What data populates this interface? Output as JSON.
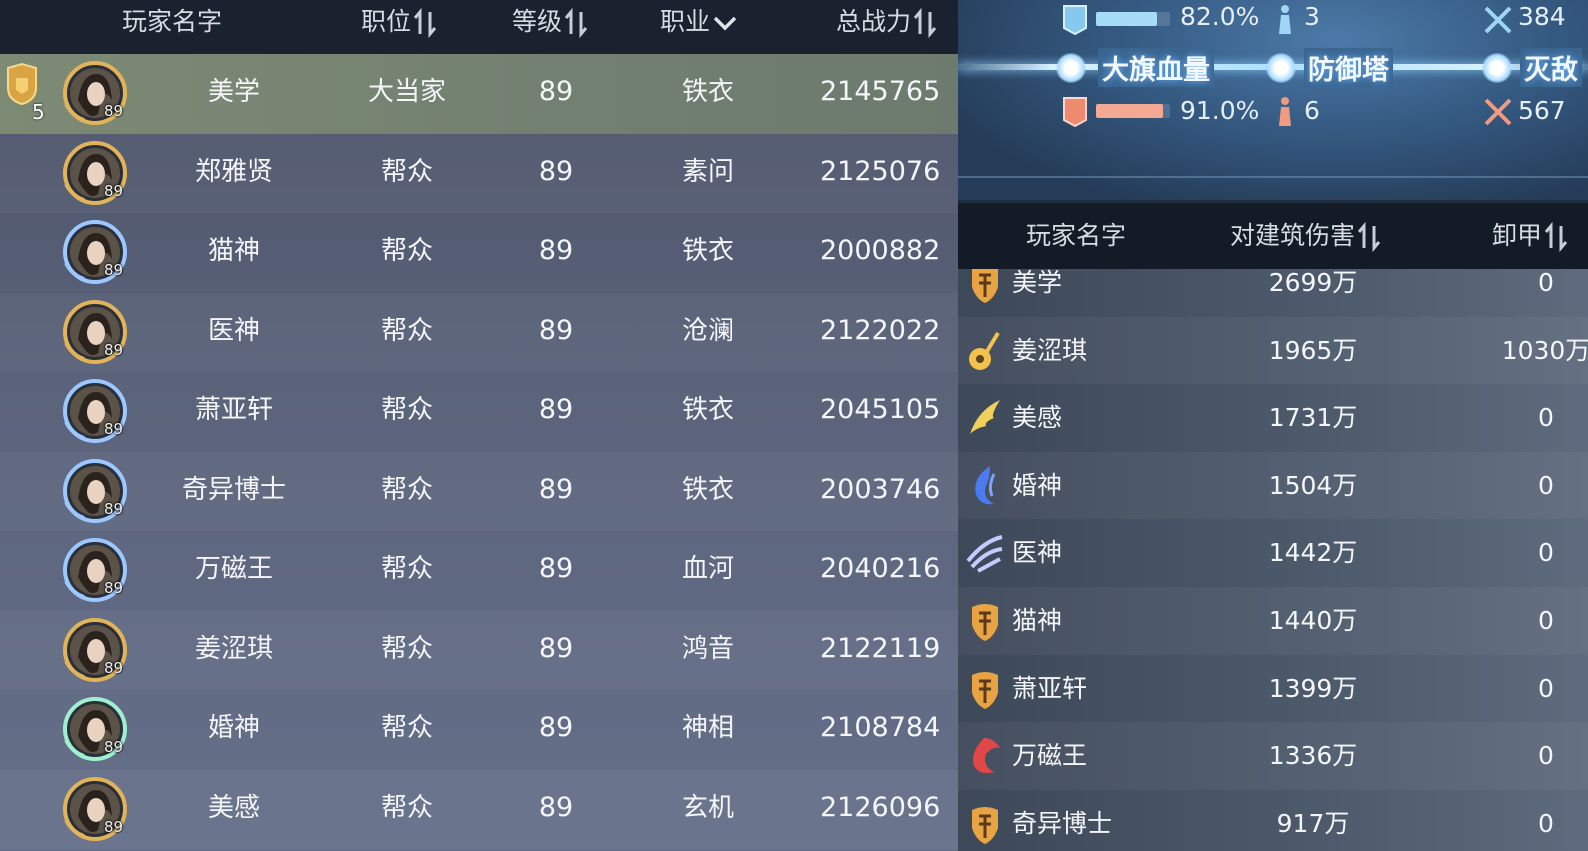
{
  "left_table": {
    "headers": {
      "name": "玩家名字",
      "position": "职位",
      "level": "等级",
      "class": "职业",
      "power": "总战力"
    },
    "selected_rank": "5",
    "rows": [
      {
        "name": "美学",
        "position": "大当家",
        "level": "89",
        "class": "铁衣",
        "power": "2145765",
        "avatar_level": "89"
      },
      {
        "name": "郑雅贤",
        "position": "帮众",
        "level": "89",
        "class": "素问",
        "power": "2125076",
        "avatar_level": "89"
      },
      {
        "name": "猫神",
        "position": "帮众",
        "level": "89",
        "class": "铁衣",
        "power": "2000882",
        "avatar_level": "89"
      },
      {
        "name": "医神",
        "position": "帮众",
        "level": "89",
        "class": "沧澜",
        "power": "2122022",
        "avatar_level": "89"
      },
      {
        "name": "萧亚轩",
        "position": "帮众",
        "level": "89",
        "class": "铁衣",
        "power": "2045105",
        "avatar_level": "89"
      },
      {
        "name": "奇异博士",
        "position": "帮众",
        "level": "89",
        "class": "铁衣",
        "power": "2003746",
        "avatar_level": "89"
      },
      {
        "name": "万磁王",
        "position": "帮众",
        "level": "89",
        "class": "血河",
        "power": "2040216",
        "avatar_level": "89"
      },
      {
        "name": "姜涩琪",
        "position": "帮众",
        "level": "89",
        "class": "鸿音",
        "power": "2122119",
        "avatar_level": "89"
      },
      {
        "name": "婚神",
        "position": "帮众",
        "level": "89",
        "class": "神相",
        "power": "2108784",
        "avatar_level": "89"
      },
      {
        "name": "美感",
        "position": "帮众",
        "level": "89",
        "class": "玄机",
        "power": "2126096",
        "avatar_level": "89"
      }
    ]
  },
  "objectives": {
    "blue_team": {
      "flag_hp": "82.0%",
      "flag_hp_fraction": 0.82,
      "towers": "3",
      "kills": "384"
    },
    "red_team": {
      "flag_hp": "91.0%",
      "flag_hp_fraction": 0.91,
      "towers": "6",
      "kills": "567"
    },
    "labels": {
      "flag": "大旗血量",
      "tower": "防御塔",
      "kill": "灭敌"
    }
  },
  "right_table": {
    "headers": {
      "name": "玩家名字",
      "building_damage": "对建筑伤害",
      "armor_break": "卸甲"
    },
    "rows": [
      {
        "name": "美学",
        "building_damage": "2699万",
        "armor_break": "0",
        "class_icon": "tieyi-icon"
      },
      {
        "name": "姜涩琪",
        "building_damage": "1965万",
        "armor_break": "1030万",
        "class_icon": "hongyin-icon"
      },
      {
        "name": "美感",
        "building_damage": "1731万",
        "armor_break": "0",
        "class_icon": "xuanji-icon"
      },
      {
        "name": "婚神",
        "building_damage": "1504万",
        "armor_break": "0",
        "class_icon": "shenxiang-icon"
      },
      {
        "name": "医神",
        "building_damage": "1442万",
        "armor_break": "0",
        "class_icon": "canglan-icon"
      },
      {
        "name": "猫神",
        "building_damage": "1440万",
        "armor_break": "0",
        "class_icon": "tieyi-icon"
      },
      {
        "name": "萧亚轩",
        "building_damage": "1399万",
        "armor_break": "0",
        "class_icon": "tieyi-icon"
      },
      {
        "name": "万磁王",
        "building_damage": "1336万",
        "armor_break": "0",
        "class_icon": "xuehe-icon"
      },
      {
        "name": "奇异博士",
        "building_damage": "917万",
        "armor_break": "0",
        "class_icon": "tieyi-icon"
      }
    ]
  },
  "colors": {
    "selected_row": "#7d8a74",
    "blue_bar": "#9fd6f5",
    "red_bar": "#f0a088",
    "gold_icon": "#e8a640",
    "header_bg": "#1a2230"
  }
}
